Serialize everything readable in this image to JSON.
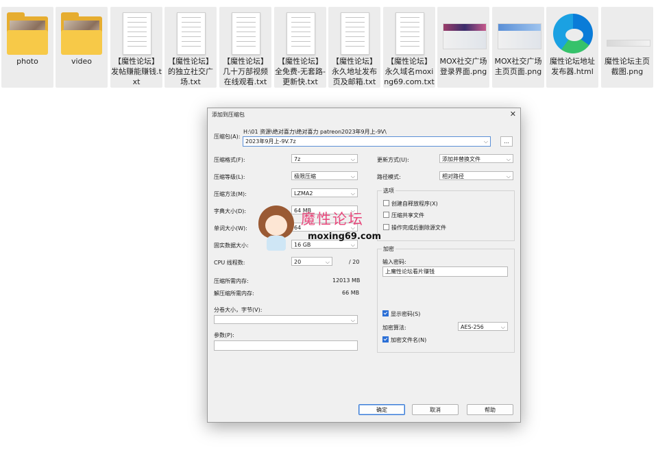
{
  "files": [
    {
      "name": "photo",
      "kind": "folder"
    },
    {
      "name": "video",
      "kind": "folder"
    },
    {
      "name": "【魔性论坛】发帖赚能赚钱.txt",
      "kind": "txt"
    },
    {
      "name": "【魔性论坛】的独立社交广场.txt",
      "kind": "txt"
    },
    {
      "name": "【魔性论坛】几十万部视频在线观看.txt",
      "kind": "txt"
    },
    {
      "name": "【魔性论坛】全免费-无套路-更新快.txt",
      "kind": "txt"
    },
    {
      "name": "【魔性论坛】永久地址发布页及邮箱.txt",
      "kind": "txt"
    },
    {
      "name": "【魔性论坛】永久域名moxing69.com.txt",
      "kind": "txt"
    },
    {
      "name": "MOX社交广场登录界面.png",
      "kind": "png"
    },
    {
      "name": "MOX社交广场主页页面.png",
      "kind": "png"
    },
    {
      "name": "魔性论坛地址发布器.html",
      "kind": "html"
    },
    {
      "name": "魔性论坛主页截图.png",
      "kind": "png"
    }
  ],
  "dialog": {
    "title": "添加到压缩包",
    "close_label": "✕",
    "archive_label": "压缩包(A):",
    "archive_path": "H:\\01 资源\\绝对喜力\\绝对喜力 patreon2023年9月上-9V\\",
    "archive_name": "2023年9月上-9V.7z",
    "browse_label": "...",
    "format_label": "压缩格式(F):",
    "format_value": "7z",
    "level_label": "压缩等级(L):",
    "level_value": "极限压缩",
    "method_label": "压缩方法(M):",
    "method_value": "LZMA2",
    "dict_label": "字典大小(D):",
    "dict_value": "64 MB",
    "word_label": "单词大小(W):",
    "word_value": "64",
    "solid_label": "固实数据大小:",
    "solid_value": "16 GB",
    "cpu_label": "CPU 线程数:",
    "cpu_value": "20",
    "cpu_total": "/ 20",
    "mem_comp_label": "压缩所需内存:",
    "mem_comp_value": "12013 MB",
    "mem_decomp_label": "解压缩所需内存:",
    "mem_decomp_value": "66 MB",
    "split_label": "分卷大小，字节(V):",
    "split_value": "",
    "params_label": "参数(P):",
    "params_value": "",
    "update_label": "更新方式(U):",
    "update_value": "添加并替换文件",
    "path_label": "路径模式:",
    "path_value": "相对路径",
    "options_title": "选项",
    "opt_sfx": "创建自释放程序(X)",
    "opt_shared": "压缩共享文件",
    "opt_delete": "操作完成后删除源文件",
    "encrypt_title": "加密",
    "password_label": "输入密码:",
    "password_value": "上魔性论坛看片赚钱",
    "show_password": "显示密码(S)",
    "enc_method_label": "加密算法:",
    "enc_method_value": "AES-256",
    "encrypt_names": "加密文件名(N)",
    "ok_label": "确定",
    "cancel_label": "取消",
    "help_label": "帮助"
  },
  "watermark": {
    "brand": "魔性论坛",
    "url": "moxing69.com"
  }
}
